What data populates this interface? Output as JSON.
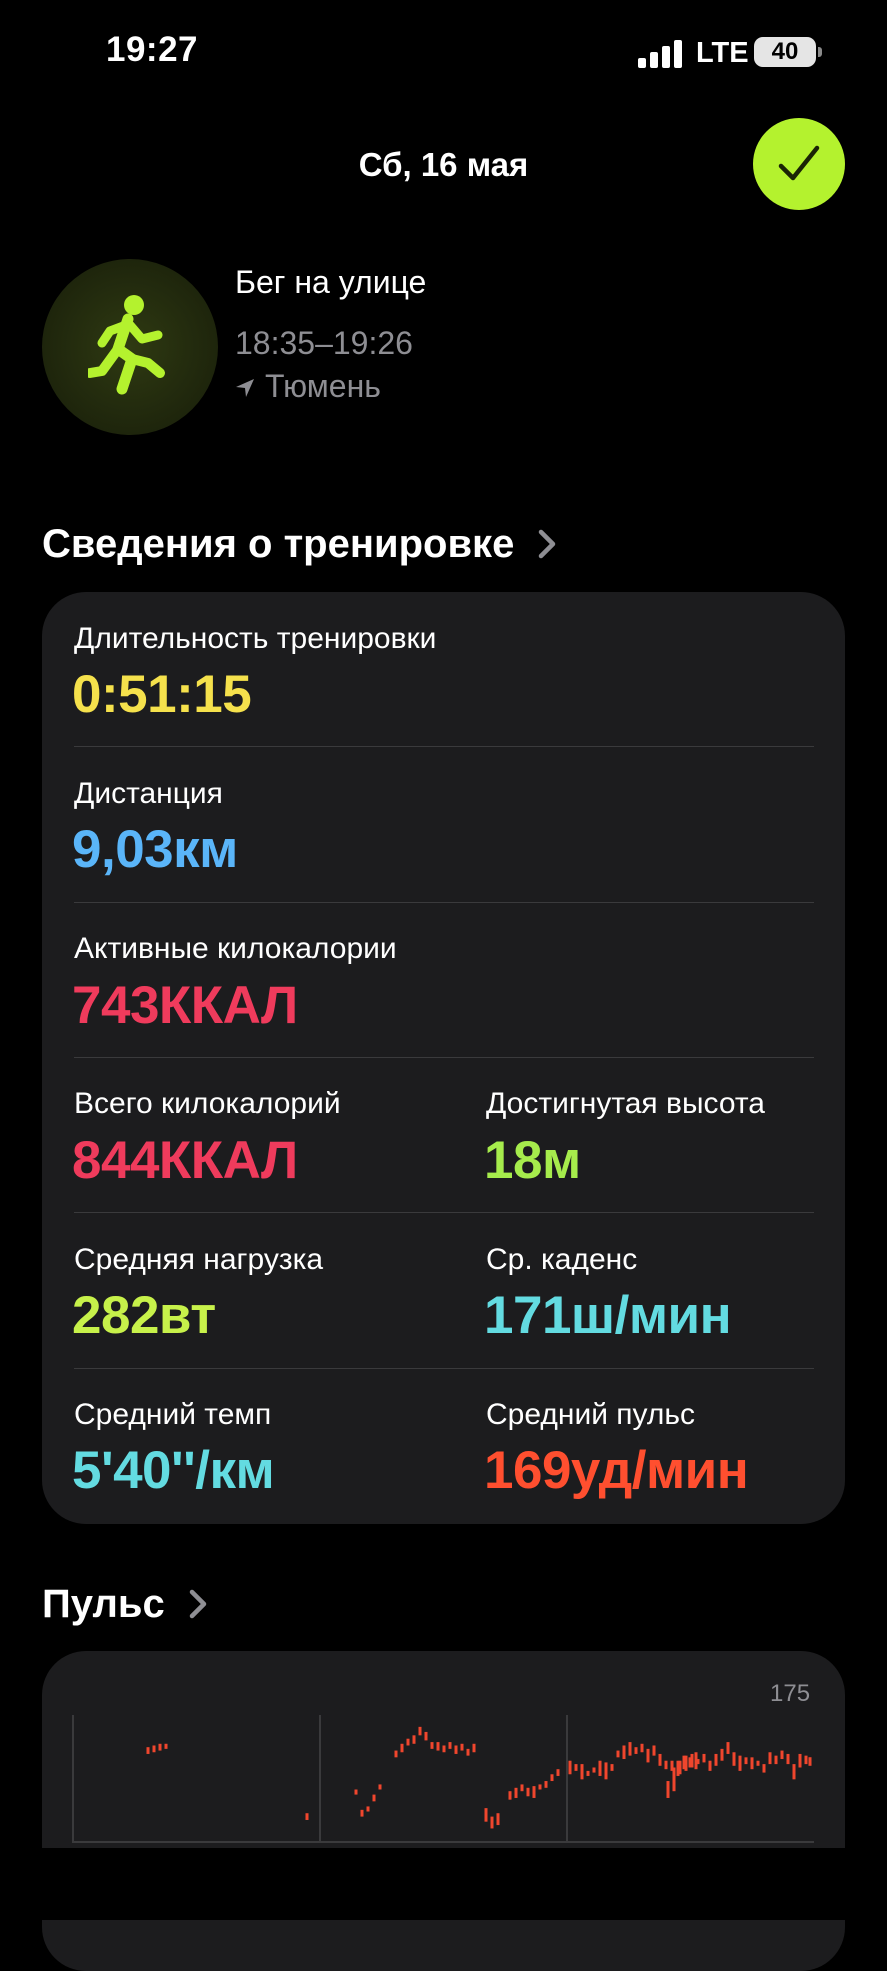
{
  "status_bar": {
    "time": "19:27",
    "network": "LTE",
    "battery": "40"
  },
  "header": {
    "date": "Сб, 16 мая"
  },
  "workout": {
    "name": "Бег на улице",
    "time_range": "18:35–19:26",
    "location": "Тюмень"
  },
  "details": {
    "title": "Сведения о тренировке",
    "metrics": [
      {
        "label": "Длительность тренировки",
        "value": "0:51:15",
        "color": "#f5e14c"
      },
      {
        "label": "Дистанция",
        "value": "9,03км",
        "color": "#5ab5f9"
      },
      {
        "label": "Активные килокалории",
        "value": "743ККАЛ",
        "color": "#ef3b5c"
      },
      {
        "label": "Всего килокалорий",
        "value": "844ККАЛ",
        "color": "#ef3b5c"
      },
      {
        "label": "Достигнутая высота",
        "value": "18м",
        "color": "#a6ec4c"
      },
      {
        "label": "Средняя нагрузка",
        "value": "282вт",
        "color": "#c7f14a"
      },
      {
        "label": "Ср. каденс",
        "value": "171ш/мин",
        "color": "#63dbe1"
      },
      {
        "label": "Средний темп",
        "value": "5'40''/км",
        "color": "#63dbe1"
      },
      {
        "label": "Средний пульс",
        "value": "169уд/мин",
        "color": "#ff4f2f"
      }
    ]
  },
  "pulse": {
    "title": "Пульс",
    "max_label": "175"
  },
  "chart_data": {
    "type": "bar",
    "series_color": "#f0462d",
    "ylim": [
      100,
      175
    ],
    "ranges": [
      [
        152,
        156
      ],
      [
        153,
        157
      ],
      [
        154,
        158
      ],
      [
        155,
        158
      ],
      [
        113,
        117
      ],
      [
        128,
        131
      ],
      [
        115,
        119
      ],
      [
        118,
        121
      ],
      [
        124,
        128
      ],
      [
        131,
        134
      ],
      [
        150,
        154
      ],
      [
        153,
        158
      ],
      [
        157,
        161
      ],
      [
        158,
        163
      ],
      [
        163,
        168
      ],
      [
        160,
        165
      ],
      [
        155,
        159
      ],
      [
        154,
        159
      ],
      [
        153,
        157
      ],
      [
        155,
        159
      ],
      [
        152,
        157
      ],
      [
        154,
        158
      ],
      [
        151,
        155
      ],
      [
        153,
        158
      ],
      [
        112,
        120
      ],
      [
        108,
        115
      ],
      [
        110,
        117
      ],
      [
        125,
        130
      ],
      [
        126,
        132
      ],
      [
        130,
        134
      ],
      [
        127,
        132
      ],
      [
        126,
        133
      ],
      [
        131,
        134
      ],
      [
        132,
        136
      ],
      [
        136,
        140
      ],
      [
        139,
        143
      ],
      [
        140,
        148
      ],
      [
        142,
        146
      ],
      [
        137,
        146
      ],
      [
        139,
        142
      ],
      [
        141,
        144
      ],
      [
        139,
        148
      ],
      [
        137,
        147
      ],
      [
        142,
        146
      ],
      [
        150,
        154
      ],
      [
        149,
        157
      ],
      [
        151,
        159
      ],
      [
        152,
        156
      ],
      [
        153,
        158
      ],
      [
        147,
        155
      ],
      [
        151,
        157
      ],
      [
        145,
        152
      ],
      [
        143,
        148
      ],
      [
        142,
        148
      ],
      [
        139,
        148
      ],
      [
        143,
        151
      ],
      [
        144,
        150
      ],
      [
        143,
        153
      ],
      [
        126,
        136
      ],
      [
        130,
        144
      ],
      [
        140,
        148
      ],
      [
        142,
        151
      ],
      [
        144,
        152
      ],
      [
        146,
        149
      ],
      [
        147,
        152
      ],
      [
        142,
        148
      ],
      [
        145,
        152
      ],
      [
        148,
        155
      ],
      [
        152,
        159
      ],
      [
        145,
        153
      ],
      [
        142,
        151
      ],
      [
        146,
        150
      ],
      [
        143,
        150
      ],
      [
        145,
        148
      ],
      [
        141,
        146
      ],
      [
        146,
        153
      ],
      [
        146,
        151
      ],
      [
        149,
        154
      ],
      [
        146,
        152
      ],
      [
        137,
        146
      ],
      [
        144,
        152
      ],
      [
        146,
        151
      ],
      [
        145,
        150
      ],
      [
        148,
        150
      ]
    ]
  }
}
